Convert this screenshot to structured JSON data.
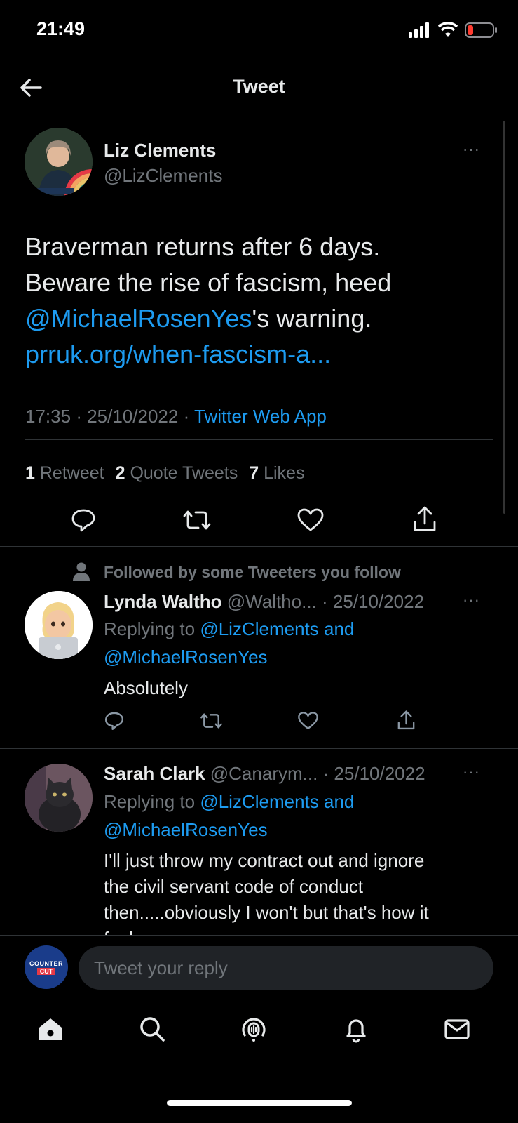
{
  "status_bar": {
    "time": "21:49"
  },
  "header": {
    "title": "Tweet"
  },
  "main_tweet": {
    "author_name": "Liz Clements",
    "author_handle": "@LizClements",
    "text_line1": "Braverman returns after 6 days.",
    "text_line2": "Beware the rise of fascism, heed",
    "mention": "@MichaelRosenYes",
    "mention_suffix": "'s warning.",
    "url": "prruk.org/when-fascism-a...",
    "time": "17:35",
    "date": "25/10/2022",
    "source": "Twitter Web App",
    "separator": "·",
    "retweet_count": "1",
    "retweet_label": "Retweet",
    "quote_count": "2",
    "quote_label": "Quote Tweets",
    "like_count": "7",
    "like_label": "Likes",
    "more": "···"
  },
  "social_context": "Followed by some Tweeters you follow",
  "replies": [
    {
      "author_name": "Lynda Waltho",
      "author_handle": "@Waltho...",
      "date": "· 25/10/2022",
      "replying_prefix": "Replying to",
      "replying_to": "@LizClements and",
      "replying_to2": "@MichaelRosenYes",
      "text": "Absolutely"
    },
    {
      "author_name": "Sarah Clark",
      "author_handle": "@Canarym...",
      "date": "· 25/10/2022",
      "replying_prefix": "Replying to",
      "replying_to": "@LizClements and",
      "replying_to2": "@MichaelRosenYes",
      "text_line1": "I'll just throw my contract out and ignore",
      "text_line2": "the civil servant code of conduct",
      "text_line3": "then.....obviously I won't but that's how it",
      "text_line4": "feels..."
    }
  ],
  "composer": {
    "placeholder": "Tweet your reply",
    "avatar_text_top": "COUNTER",
    "avatar_text_bottom": "CUT"
  },
  "icons": {
    "back": "arrow-left-icon",
    "reply": "reply-icon",
    "retweet": "retweet-icon",
    "like": "heart-icon",
    "share": "share-icon",
    "home": "home-icon",
    "search": "search-icon",
    "spaces": "spaces-icon",
    "notifications": "bell-icon",
    "messages": "mail-icon"
  },
  "colors": {
    "accent": "#1d9bf0",
    "background": "#000000",
    "muted": "#71767b",
    "battery_low": "#ff3b30"
  }
}
